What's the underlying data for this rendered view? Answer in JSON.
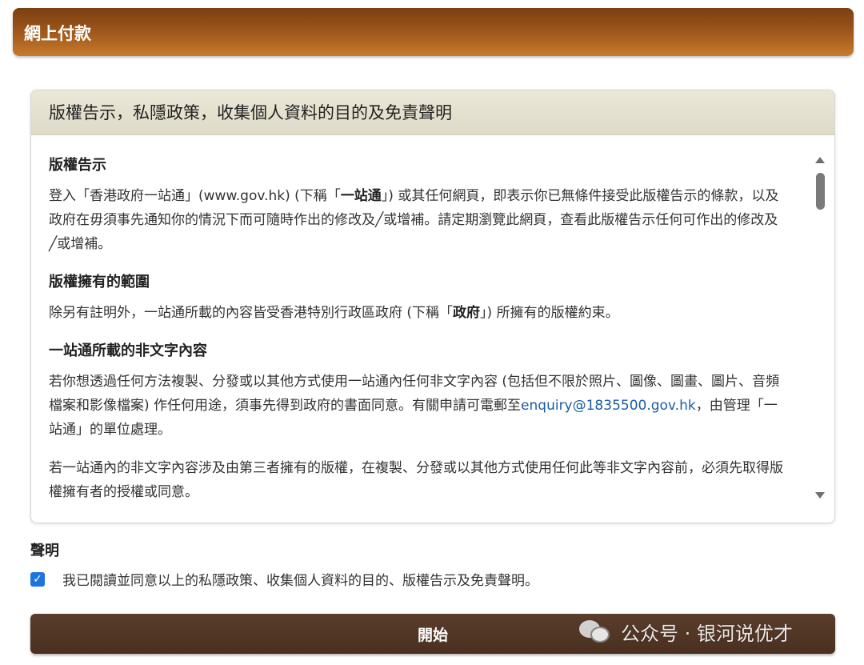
{
  "header": {
    "title": "網上付款"
  },
  "panel": {
    "title": "版權告示，私隱政策，收集個人資料的目的及免責聲明",
    "sections": [
      {
        "title": "版權告示",
        "text_a": "登入「香港政府一站通」(www.gov.hk) (下稱「",
        "text_bold": "一站通",
        "text_b": "」) 或其任何網頁，即表示你已無條件接受此版權告示的條款，以及政府在毋須事先通知你的情況下而可隨時作出的修改及╱或增補。請定期瀏覽此網頁，查看此版權告示任何可作出的修改及╱或增補。"
      },
      {
        "title": "版權擁有的範圍",
        "text_a": "除另有註明外，一站通所載的內容皆受香港特別行政區政府 (下稱「",
        "text_bold": "政府",
        "text_b": "」) 所擁有的版權約束。"
      },
      {
        "title": "一站通所載的非文字內容",
        "text_a": "若你想透過任何方法複製、分發或以其他方式使用一站通內任何非文字內容 (包括但不限於照片、圖像、圖畫、圖片、音頻檔案和影像檔案) 作任何用途，須事先得到政府的書面同意。有關申請可電郵至",
        "link": "enquiry@1835500.gov.hk",
        "text_b": "，由管理「一站通」的單位處理。",
        "text_c": "若一站通內的非文字內容涉及由第三者擁有的版權，在複製、分發或以其他方式使用任何此等非文字內容前，必須先取得版權擁有者的授權或同意。"
      }
    ]
  },
  "declaration": {
    "label": "聲明",
    "checkbox_checked": true,
    "checkbox_text": "我已閱讀並同意以上的私隱政策、收集個人資料的目的、版權告示及免責聲明。"
  },
  "start_button": {
    "label": "開始"
  },
  "watermark": {
    "text": "公众号 · 银河说优才"
  },
  "colors": {
    "header": "#9b541a",
    "button": "#4a2f20",
    "link": "#1a5da6",
    "checkbox": "#1d74e0"
  }
}
